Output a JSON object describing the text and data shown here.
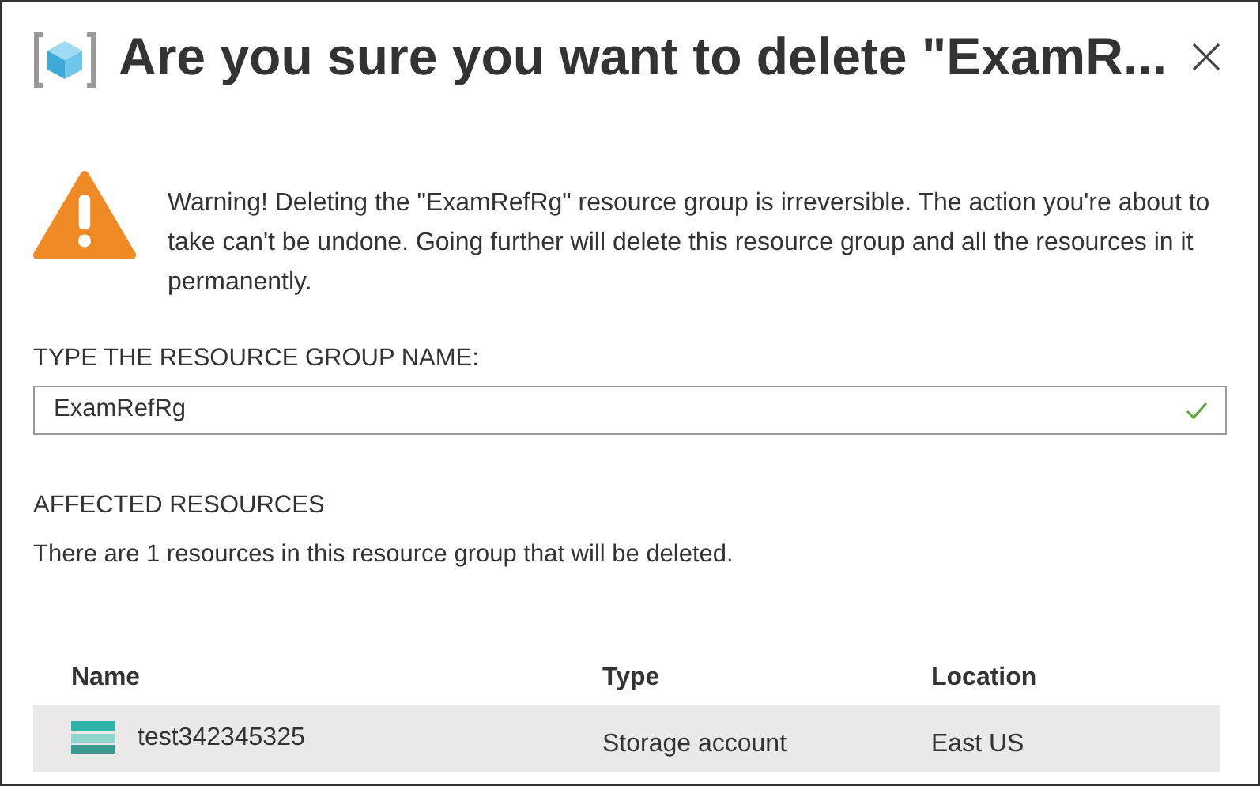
{
  "dialog": {
    "title": "Are you sure you want to delete \"ExamR..."
  },
  "warning": {
    "text": "Warning! Deleting the \"ExamRefRg\" resource group is irreversible. The action you're about to take can't be undone. Going further will delete this resource group and all the resources in it permanently."
  },
  "name_field": {
    "label": "TYPE THE RESOURCE GROUP NAME:",
    "value": "ExamRefRg",
    "valid": true
  },
  "affected": {
    "heading": "AFFECTED RESOURCES",
    "summary": "There are 1 resources in this resource group that will be deleted."
  },
  "table": {
    "columns": [
      "Name",
      "Type",
      "Location"
    ],
    "rows": [
      {
        "name": "test342345325",
        "type": "Storage account",
        "location": "East US",
        "selected": true
      }
    ]
  }
}
